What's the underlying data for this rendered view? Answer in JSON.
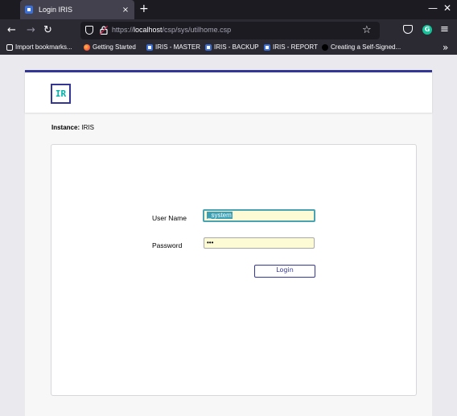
{
  "browser": {
    "tab_title": "Login IRIS",
    "tab_close": "×",
    "new_tab": "+",
    "url_prefix": "https://",
    "url_host": "localhost",
    "url_path": "/csp/sys/utilhome.csp",
    "bookmarks": [
      {
        "label": "Import bookmarks...",
        "icon": "import-icon"
      },
      {
        "label": "Getting Started",
        "icon": "firefox-icon"
      },
      {
        "label": "IRIS - MASTER",
        "icon": "iris-icon"
      },
      {
        "label": "IRIS - BACKUP",
        "icon": "iris-icon"
      },
      {
        "label": "IRIS - REPORT",
        "icon": "iris-icon"
      },
      {
        "label": "Creating a Self-Signed...",
        "icon": "web-icon"
      }
    ]
  },
  "page": {
    "logo_text": "IR",
    "instance_label": "Instance:",
    "instance_value": "IRIS",
    "username_label": "User Name",
    "username_value": "_system",
    "password_label": "Password",
    "password_value": "•••",
    "login_button": "Login"
  },
  "colors": {
    "brand": "#333695",
    "accent": "#00b2a9",
    "input_bg": "#fdfbd6"
  }
}
